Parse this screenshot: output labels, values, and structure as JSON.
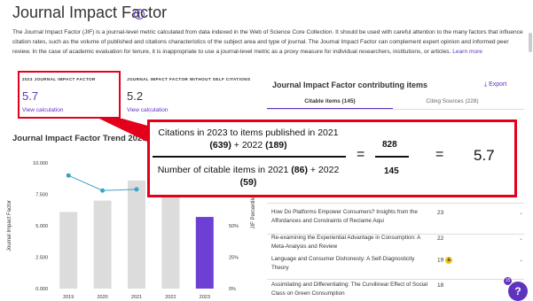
{
  "page": {
    "title": "Journal Impact Factor",
    "info_icon": "info-circle-icon",
    "description": "The Journal Impact Factor (JIF) is a journal-level metric calculated from data indexed in the Web of Science Core Collection. It should be used with careful attention to the many factors that influence citation rates, such as the volume of published and citations characteristics of the subject area and type of journal. The Journal Impact Factor can complement expert opinion and informed peer review. In the case of academic evaluation for tenure, it is inappropriate to use a journal-level metric as a proxy measure for individual researchers, institutions, or articles.",
    "learn_more": "Learn more"
  },
  "metrics": {
    "jif": {
      "label": "2023 JOURNAL IMPACT FACTOR",
      "value": "5.7",
      "link": "View calculation"
    },
    "jif_no_self": {
      "label": "JOURNAL IMPACT FACTOR WITHOUT SELF CITATIONS",
      "value": "5.2",
      "link": "View calculation"
    }
  },
  "trend": {
    "title": "Journal Impact Factor Trend 2023"
  },
  "chart_data": {
    "type": "bar",
    "categories": [
      "2019",
      "2020",
      "2021",
      "2022",
      "2023"
    ],
    "series": [
      {
        "values": [
          6.1,
          7.0,
          8.6,
          7.4,
          5.7
        ],
        "colors": [
          "#dcdcdc",
          "#dcdcdc",
          "#dcdcdc",
          "#dcdcdc",
          "#6e3fd4"
        ]
      },
      {
        "values": [
          9.0,
          7.8,
          7.9
        ],
        "type": "line",
        "color": "#3aa3c9"
      }
    ],
    "ylabel": "Journal Impact Factor",
    "ylim": [
      0,
      10
    ],
    "yticks": [
      "0.000",
      "2.500",
      "5.000",
      "7.500",
      "10.000"
    ],
    "y2label": "JIF Percentile in Category",
    "y2ticks": [
      "0%",
      "25%",
      "50%"
    ]
  },
  "contributing": {
    "title": "Journal Impact Factor contributing items",
    "export_label": "Export",
    "export_icon": "download-icon",
    "tabs": [
      {
        "label": "Citable items (145)",
        "active": true
      },
      {
        "label": "Citing Sources (228)",
        "active": false
      }
    ],
    "items": [
      {
        "title": "How Do Platforms Empower Consumers? Insights from the Affordances and Constraints of Reclame Aqui",
        "count": "23",
        "oa": false
      },
      {
        "title": "Re-examining the Experiential Advantage in Consumption: A Meta-Analysis and Review",
        "count": "22",
        "oa": false
      },
      {
        "title": "Language and Consumer Dishonesty: A Self-Diagnosticity Theory",
        "count": "19",
        "oa": true,
        "oa_icon": "open-access-icon"
      },
      {
        "title": "Assimilating and Differentiating: The Curvilinear Effect of Social Class on Green Consumption",
        "count": "18",
        "oa": false
      }
    ]
  },
  "calculation": {
    "numerator_line1": "Citations in 2023 to items published in 2021",
    "numerator_line2_a": "(639)",
    "numerator_line2_b": " + 2022 ",
    "numerator_line2_c": "(189)",
    "denominator_line1_a": "Number of citable items in 2021 ",
    "denominator_line1_b": "(86)",
    "denominator_line1_c": " + 2022",
    "denominator_line2": "(59)",
    "equals": "=",
    "num_value": "828",
    "den_value": "145",
    "result": "5.7"
  },
  "help": {
    "badge": "15",
    "label": "?"
  },
  "colors": {
    "accent": "#5e33bf",
    "highlight": "#e3001b",
    "line": "#3aa3c9"
  }
}
